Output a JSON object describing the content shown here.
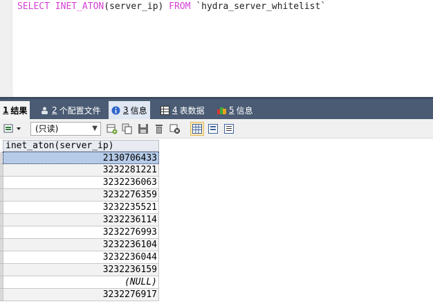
{
  "editor": {
    "kw_select": "SELECT",
    "fn": "INET_ATON",
    "arg": "(server_ip)",
    "kw_from": "FROM",
    "table": "`hydra_server_whitelist`"
  },
  "tabs": [
    {
      "num": "1",
      "label": "结果"
    },
    {
      "num": "2",
      "label": "个配置文件"
    },
    {
      "num": "3",
      "label": "信息"
    },
    {
      "num": "4",
      "label": "表数据"
    },
    {
      "num": "5",
      "label": "信息"
    }
  ],
  "toolbar": {
    "mode_select": "(只读)"
  },
  "grid": {
    "column": "inet_aton(server_ip)",
    "rows": [
      "2130706433",
      "3232281221",
      "3232236063",
      "3232276359",
      "3232235521",
      "3232236114",
      "3232276993",
      "3232236104",
      "3232236044",
      "3232236159",
      "(NULL)",
      "3232276917"
    ]
  },
  "colors": {
    "keyword": "#d43fd4",
    "tabbar": "#4a5b73",
    "selected_row": "#b6cbe8"
  }
}
